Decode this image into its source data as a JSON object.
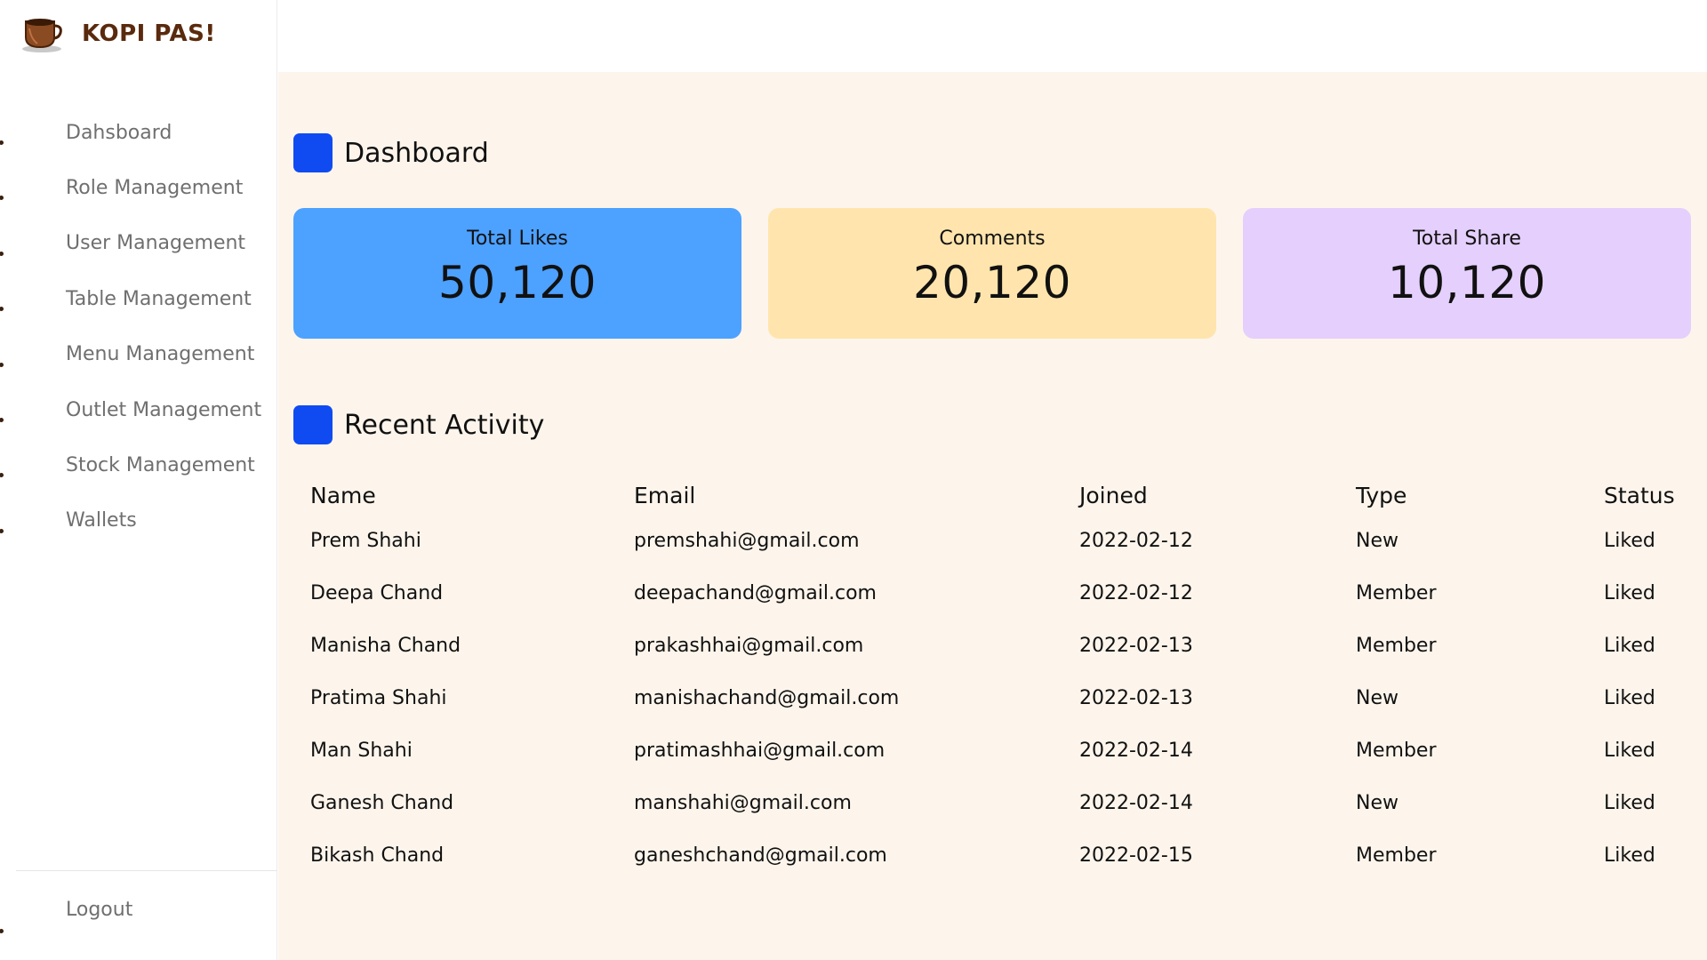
{
  "brand": {
    "name": "KOPI PAS!",
    "icon": "coffee-cup-icon"
  },
  "sidebar": {
    "items": [
      {
        "label": "Dahsboard"
      },
      {
        "label": "Role Management"
      },
      {
        "label": "User Management"
      },
      {
        "label": "Table Management"
      },
      {
        "label": "Menu Management"
      },
      {
        "label": "Outlet Management"
      },
      {
        "label": "Stock Management"
      },
      {
        "label": "Wallets"
      }
    ],
    "logout": "Logout"
  },
  "dashboard": {
    "title": "Dashboard",
    "cards": [
      {
        "label": "Total Likes",
        "value": "50,120",
        "color": "#4da1ff"
      },
      {
        "label": "Comments",
        "value": "20,120",
        "color": "#ffe5ad"
      },
      {
        "label": "Total Share",
        "value": "10,120",
        "color": "#e5cffc"
      }
    ]
  },
  "activity": {
    "title": "Recent Activity",
    "columns": [
      "Name",
      "Email",
      "Joined",
      "Type",
      "Status"
    ],
    "rows": [
      [
        "Prem Shahi",
        "premshahi@gmail.com",
        "2022-02-12",
        "New",
        "Liked"
      ],
      [
        "Deepa Chand",
        "deepachand@gmail.com",
        "2022-02-12",
        "Member",
        "Liked"
      ],
      [
        "Manisha Chand",
        "prakashhai@gmail.com",
        "2022-02-13",
        "Member",
        "Liked"
      ],
      [
        "Pratima Shahi",
        "manishachand@gmail.com",
        "2022-02-13",
        "New",
        "Liked"
      ],
      [
        "Man Shahi",
        "pratimashhai@gmail.com",
        "2022-02-14",
        "Member",
        "Liked"
      ],
      [
        "Ganesh Chand",
        "manshahi@gmail.com",
        "2022-02-14",
        "New",
        "Liked"
      ],
      [
        "Bikash Chand",
        "ganeshchand@gmail.com",
        "2022-02-15",
        "Member",
        "Liked"
      ]
    ]
  },
  "colors": {
    "accent": "#0f4bf0",
    "brand": "#5a2a0e",
    "main_bg": "#fdf5ec"
  }
}
